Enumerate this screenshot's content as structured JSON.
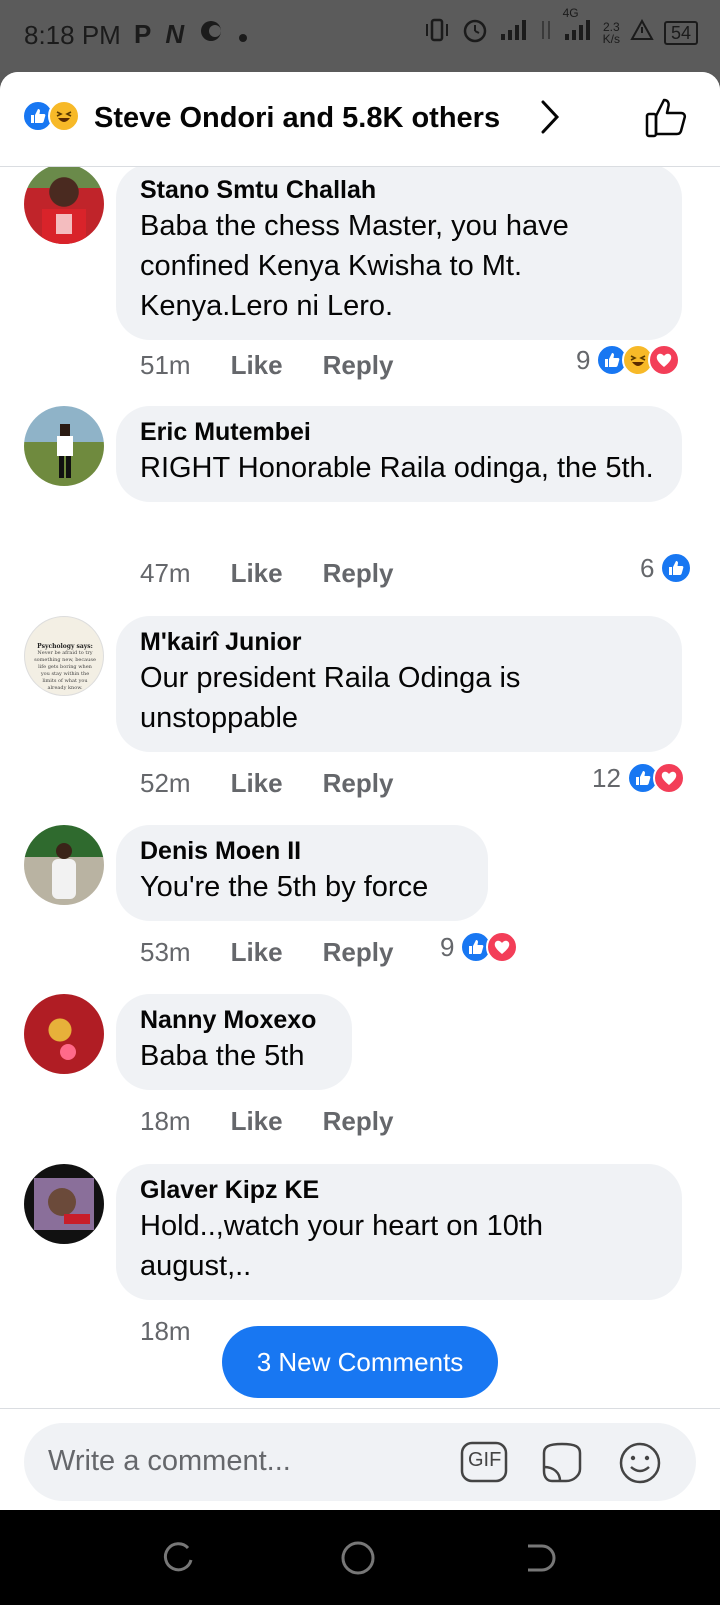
{
  "status_bar": {
    "time": "8:18 PM",
    "left_icons": [
      "P",
      "N"
    ],
    "network": "4G",
    "speed": "2.3",
    "speed_unit": "K/s",
    "battery": "54"
  },
  "reactions_header": {
    "text": "Steve Ondori and 5.8K others"
  },
  "comments": [
    {
      "name": "Stano Smtu Challah",
      "text": "Baba the chess Master, you have confined Kenya Kwisha to Mt. Kenya.Lero ni Lero.",
      "time": "51m",
      "like": "Like",
      "reply": "Reply",
      "reaction_count": "9",
      "reactions": [
        "like",
        "haha",
        "love"
      ]
    },
    {
      "name": "Eric Mutembei",
      "text": "RIGHT Honorable Raila odinga, the 5th.",
      "time": "47m",
      "like": "Like",
      "reply": "Reply",
      "reaction_count": "6",
      "reactions": [
        "like"
      ]
    },
    {
      "name": "M'kairî Junior",
      "text": "Our president Raila Odinga is unstoppable",
      "time": "52m",
      "like": "Like",
      "reply": "Reply",
      "reaction_count": "12",
      "reactions": [
        "like",
        "love"
      ]
    },
    {
      "name": "Denis Moen II",
      "text": "You're the 5th by force",
      "time": "53m",
      "like": "Like",
      "reply": "Reply",
      "reaction_count": "9",
      "reactions": [
        "like",
        "love"
      ]
    },
    {
      "name": "Nanny Moxexo",
      "text": "Baba the 5th",
      "time": "18m",
      "like": "Like",
      "reply": "Reply",
      "reaction_count": "",
      "reactions": []
    },
    {
      "name": "Glaver Kipz KE",
      "text": "Hold..,watch your heart on 10th august,..",
      "time": "18m",
      "like": "Like",
      "reply": "Reply",
      "reaction_count": "",
      "reactions": []
    }
  ],
  "avatar_texts": {
    "psychology_title": "Psychology says:",
    "psychology_body": "Never be afraid to try something new, because life gets boring when you stay within the limits of what you already know."
  },
  "new_comments_button": "3 New Comments",
  "composer": {
    "placeholder": "Write a comment...",
    "gif_label": "GIF"
  },
  "colors": {
    "accent": "#1877f2",
    "like": "#1877f2",
    "love": "#f33e58",
    "haha": "#f7b928",
    "bubble": "#f0f2f5",
    "meta": "#65676b"
  }
}
